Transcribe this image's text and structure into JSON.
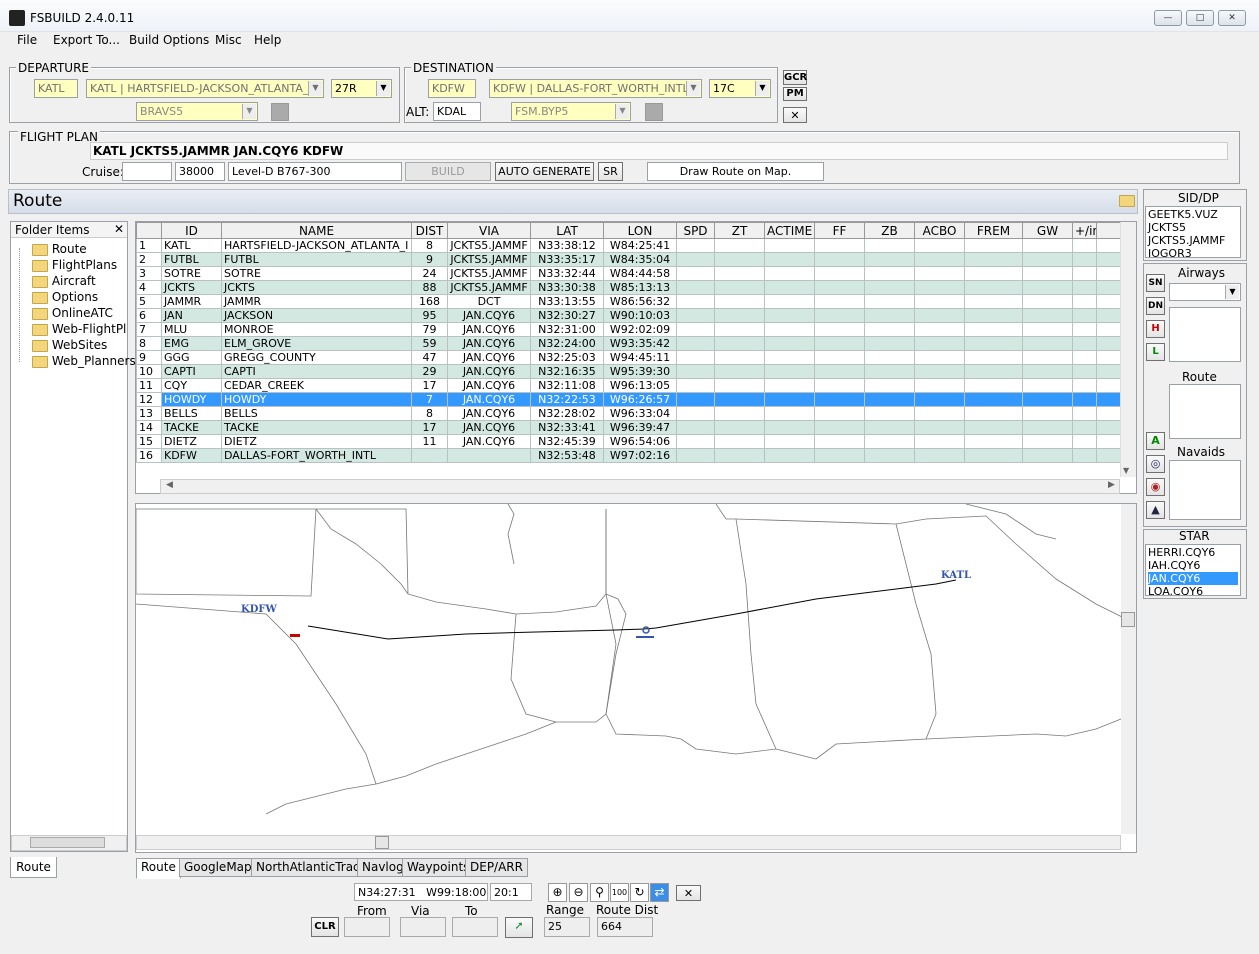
{
  "app": {
    "title": "FSBUILD 2.4.0.11"
  },
  "menu": [
    "File",
    "Export To...",
    "Build Options",
    "Misc",
    "Help"
  ],
  "departure": {
    "label": "DEPARTURE",
    "icao": "KATL",
    "airport": "KATL | HARTSFIELD-JACKSON_ATLANTA_I",
    "runway": "27R",
    "sid": "BRAVS5"
  },
  "destination": {
    "label": "DESTINATION",
    "icao": "KDFW",
    "airport": "KDFW | DALLAS-FORT_WORTH_INTL",
    "runway": "17C",
    "alt_label": "ALT:",
    "alt": "KDAL",
    "star": "FSM.BYP5"
  },
  "side_buttons": {
    "gcr": "GCR",
    "pm": "PM"
  },
  "flightplan": {
    "label": "FLIGHT PLAN",
    "route": "KATL JCKTS5.JAMMR JAN.CQY6 KDFW",
    "cruise_label": "Cruise:",
    "cruise": "",
    "fl": "38000",
    "aircraft": "Level-D B767-300",
    "build": "BUILD",
    "auto": "AUTO GENERATE",
    "sr": "SR",
    "draw": "Draw Route on Map."
  },
  "route_panel": {
    "title": "Route"
  },
  "folder": {
    "header": "Folder Items",
    "items": [
      "Route",
      "FlightPlans",
      "Aircraft",
      "Options",
      "OnlineATC",
      "Web-FlightPlans",
      "WebSites",
      "Web_Planners"
    ],
    "tab": "Route"
  },
  "grid": {
    "columns": [
      "ID",
      "NAME",
      "DIST",
      "VIA",
      "LAT",
      "LON",
      "SPD",
      "ZT",
      "ACTIME",
      "FF",
      "ZB",
      "ACBO",
      "FREM",
      "GW",
      "+/inc"
    ],
    "rows": [
      {
        "n": "1",
        "id": "KATL",
        "name": "HARTSFIELD-JACKSON_ATLANTA_I",
        "dist": "8",
        "via": "JCKTS5.JAMMF",
        "lat": "N33:38:12",
        "lon": "W84:25:41"
      },
      {
        "n": "2",
        "id": "FUTBL",
        "name": "FUTBL",
        "dist": "9",
        "via": "JCKTS5.JAMMF",
        "lat": "N33:35:17",
        "lon": "W84:35:04"
      },
      {
        "n": "3",
        "id": "SOTRE",
        "name": "SOTRE",
        "dist": "24",
        "via": "JCKTS5.JAMMF",
        "lat": "N33:32:44",
        "lon": "W84:44:58"
      },
      {
        "n": "4",
        "id": "JCKTS",
        "name": "JCKTS",
        "dist": "88",
        "via": "JCKTS5.JAMMF",
        "lat": "N33:30:38",
        "lon": "W85:13:13"
      },
      {
        "n": "5",
        "id": "JAMMR",
        "name": "JAMMR",
        "dist": "168",
        "via": "DCT",
        "lat": "N33:13:55",
        "lon": "W86:56:32"
      },
      {
        "n": "6",
        "id": "JAN",
        "name": "JACKSON",
        "dist": "95",
        "via": "JAN.CQY6",
        "lat": "N32:30:27",
        "lon": "W90:10:03"
      },
      {
        "n": "7",
        "id": "MLU",
        "name": "MONROE",
        "dist": "79",
        "via": "JAN.CQY6",
        "lat": "N32:31:00",
        "lon": "W92:02:09"
      },
      {
        "n": "8",
        "id": "EMG",
        "name": "ELM_GROVE",
        "dist": "59",
        "via": "JAN.CQY6",
        "lat": "N32:24:00",
        "lon": "W93:35:42"
      },
      {
        "n": "9",
        "id": "GGG",
        "name": "GREGG_COUNTY",
        "dist": "47",
        "via": "JAN.CQY6",
        "lat": "N32:25:03",
        "lon": "W94:45:11"
      },
      {
        "n": "10",
        "id": "CAPTI",
        "name": "CAPTI",
        "dist": "29",
        "via": "JAN.CQY6",
        "lat": "N32:16:35",
        "lon": "W95:39:30"
      },
      {
        "n": "11",
        "id": "CQY",
        "name": "CEDAR_CREEK",
        "dist": "17",
        "via": "JAN.CQY6",
        "lat": "N32:11:08",
        "lon": "W96:13:05"
      },
      {
        "n": "12",
        "id": "HOWDY",
        "name": "HOWDY",
        "dist": "7",
        "via": "JAN.CQY6",
        "lat": "N32:22:53",
        "lon": "W96:26:57"
      },
      {
        "n": "13",
        "id": "BELLS",
        "name": "BELLS",
        "dist": "8",
        "via": "JAN.CQY6",
        "lat": "N32:28:02",
        "lon": "W96:33:04"
      },
      {
        "n": "14",
        "id": "TACKE",
        "name": "TACKE",
        "dist": "17",
        "via": "JAN.CQY6",
        "lat": "N32:33:41",
        "lon": "W96:39:47"
      },
      {
        "n": "15",
        "id": "DIETZ",
        "name": "DIETZ",
        "dist": "11",
        "via": "JAN.CQY6",
        "lat": "N32:45:39",
        "lon": "W96:54:06"
      },
      {
        "n": "16",
        "id": "KDFW",
        "name": "DALLAS-FORT_WORTH_INTL",
        "dist": "",
        "via": "",
        "lat": "N32:53:48",
        "lon": "W97:02:16"
      }
    ]
  },
  "map": {
    "labels": {
      "kdfw": "KDFW",
      "katl": "KATL"
    }
  },
  "tabs": [
    "Route",
    "GoogleMaps",
    "NorthAtlanticTracks",
    "Navlog",
    "Waypoints",
    "DEP/ARR"
  ],
  "status": {
    "coords": "N34:27:31   W99:18:00",
    "ratio": "20:1",
    "from": "From",
    "via": "Via",
    "to": "To",
    "clr": "CLR",
    "range_label": "Range",
    "range": "25",
    "routedist_label": "Route Dist",
    "routedist": "664"
  },
  "right": {
    "sid_label": "SID/DP",
    "sids": [
      "GEETK5.VUZ",
      "JCKTS5",
      "JCKTS5.JAMMF",
      "JOGOR3"
    ],
    "airways_label": "Airways",
    "sn": "SN",
    "dn": "DN",
    "h": "H",
    "l": "L",
    "route_label": "Route",
    "navaids_label": "Navaids",
    "star_label": "STAR",
    "stars": [
      "HERRI.CQY6",
      "IAH.CQY6",
      "JAN.CQY6",
      "LOA.CQY6"
    ]
  }
}
